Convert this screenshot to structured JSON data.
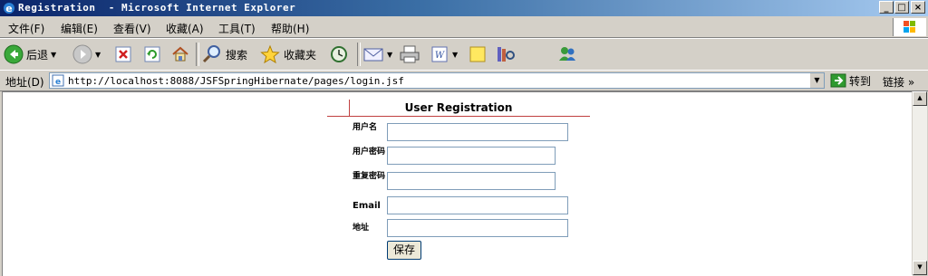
{
  "window": {
    "title": "Registration  - Microsoft Internet Explorer",
    "buttons": {
      "minimize": "_",
      "maximize": "□",
      "close": "×"
    }
  },
  "menu": {
    "items": [
      "文件(F)",
      "编辑(E)",
      "查看(V)",
      "收藏(A)",
      "工具(T)",
      "帮助(H)"
    ]
  },
  "toolbar": {
    "back_label": "后退",
    "search_label": "搜索",
    "favorites_label": "收藏夹"
  },
  "address": {
    "label": "地址(D)",
    "url": "http://localhost:8088/JSFSpringHibernate/pages/login.jsf",
    "go_label": "转到",
    "links_label": "链接",
    "more": "»"
  },
  "form": {
    "title": "User Registration",
    "fields": [
      {
        "label": "用户名",
        "value": ""
      },
      {
        "label": "用户密码",
        "value": ""
      },
      {
        "label": "重复密码",
        "value": ""
      },
      {
        "label": "Email",
        "value": ""
      },
      {
        "label": "地址",
        "value": ""
      }
    ],
    "save_label": "保存"
  },
  "colors": {
    "titlebar_start": "#0a246a",
    "titlebar_end": "#a6caf0",
    "chrome": "#d4d0c8",
    "header_rule": "#c04040"
  }
}
